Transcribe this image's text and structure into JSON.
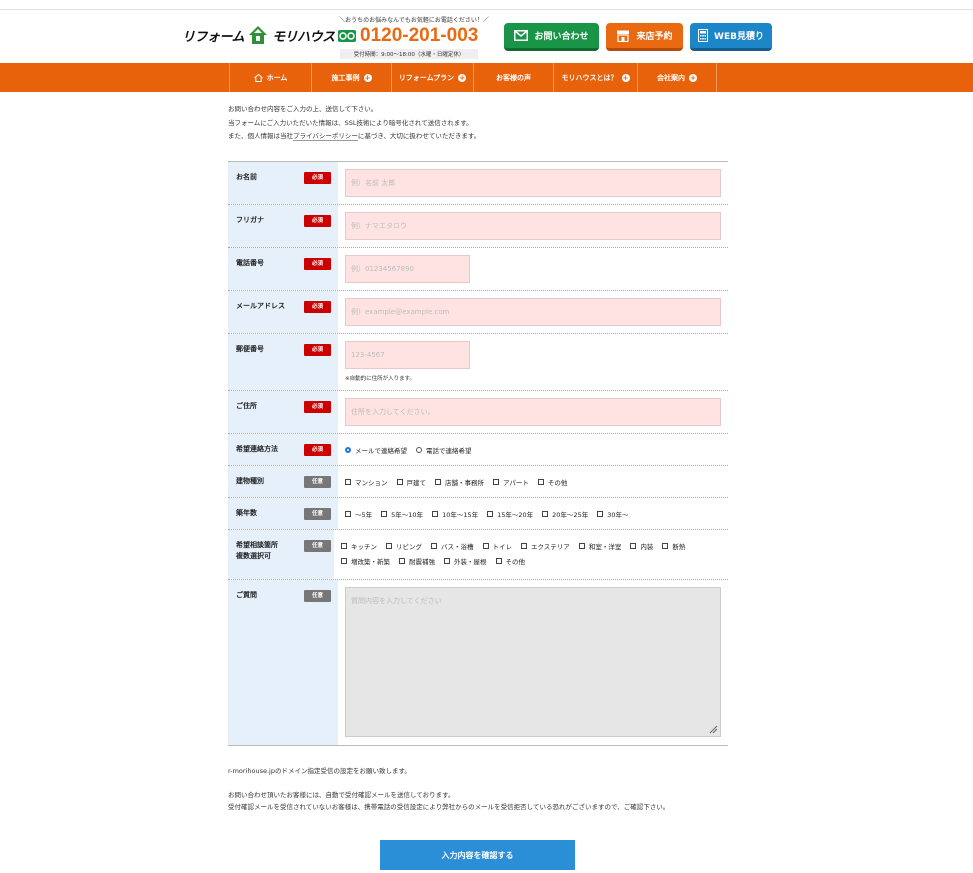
{
  "header": {
    "logo_text_left": "リフォーム",
    "logo_text_right": "モリハウス",
    "tel_catch": "＼おうちのお悩みなんでもお気軽にお電話ください！／",
    "tel_number": "0120-201-003",
    "tel_hours": "受付時間：9:00〜18:00（水曜・日曜定休）",
    "buttons": {
      "contact": "お問い合わせ",
      "visit": "来店予約",
      "web": "WEB見積り"
    }
  },
  "nav": [
    {
      "label": "ホーム"
    },
    {
      "label": "施工事例"
    },
    {
      "label": "リフォームプラン"
    },
    {
      "label": "お客様の声"
    },
    {
      "label": "モリハウスとは？"
    },
    {
      "label": "会社案内"
    }
  ],
  "intro": {
    "line1": "お問い合わせ内容をご入力の上、送信して下さい。",
    "line2": "当フォームにご入力いただいた情報は、SSL技術により暗号化されて送信されます。",
    "line3_pre": "また、個人情報は当社",
    "line3_link": "プライバシーポリシー",
    "line3_post": "に基づき、大切に扱わせていただきます。"
  },
  "badges": {
    "required": "必須",
    "optional": "任意"
  },
  "form": {
    "name": {
      "label": "お名前",
      "placeholder": "例）名前 太郎"
    },
    "kana": {
      "label": "フリガナ",
      "placeholder": "例）ナマエタロウ"
    },
    "tel": {
      "label": "電話番号",
      "placeholder": "例）01234567890"
    },
    "email": {
      "label": "メールアドレス",
      "placeholder": "例）example@example.com"
    },
    "zip": {
      "label": "郵便番号",
      "placeholder": "123-4567",
      "note": "※自動的に住所が入ります。"
    },
    "address": {
      "label": "ご住所",
      "placeholder": "住所を入力してください。"
    },
    "contact_method": {
      "label": "希望連絡方法",
      "options": [
        "メールで連絡希望",
        "電話で連絡希望"
      ],
      "selected": "メールで連絡希望"
    },
    "building": {
      "label": "建物種別",
      "options": [
        "マンション",
        "戸建て",
        "店舗・事務所",
        "アパート",
        "その他"
      ]
    },
    "age": {
      "label": "築年数",
      "options": [
        "〜5年",
        "5年〜10年",
        "10年〜15年",
        "15年〜20年",
        "20年〜25年",
        "30年〜"
      ]
    },
    "areas": {
      "label1": "希望相談箇所",
      "label2": "複数選択可",
      "options": [
        "キッチン",
        "リビング",
        "バス・浴槽",
        "トイレ",
        "エクステリア",
        "和室・洋室",
        "内装",
        "断熱",
        "増改築・新築",
        "耐震補強",
        "外装・屋根",
        "その他"
      ]
    },
    "question": {
      "label": "ご質問",
      "placeholder": "質問内容を入力してください"
    }
  },
  "notes": {
    "line1": "r-morihouse.jpのドメイン指定受信の設定をお願い致します。",
    "line2": "お問い合わせ頂いたお客様には、自動で受付確認メールを送信しております。",
    "line3": "受付確認メールを受信されていないお客様は、携帯電話の受信設定により弊社からのメールを受信拒否している恐れがございますので、ご確認下さい。"
  },
  "submit_label": "入力内容を確認する",
  "colors": {
    "brand_orange": "#e8620c",
    "contact_green": "#1a9446",
    "web_blue": "#1c86c8",
    "required_red": "#cc0000",
    "submit_blue": "#2b8fd8"
  }
}
